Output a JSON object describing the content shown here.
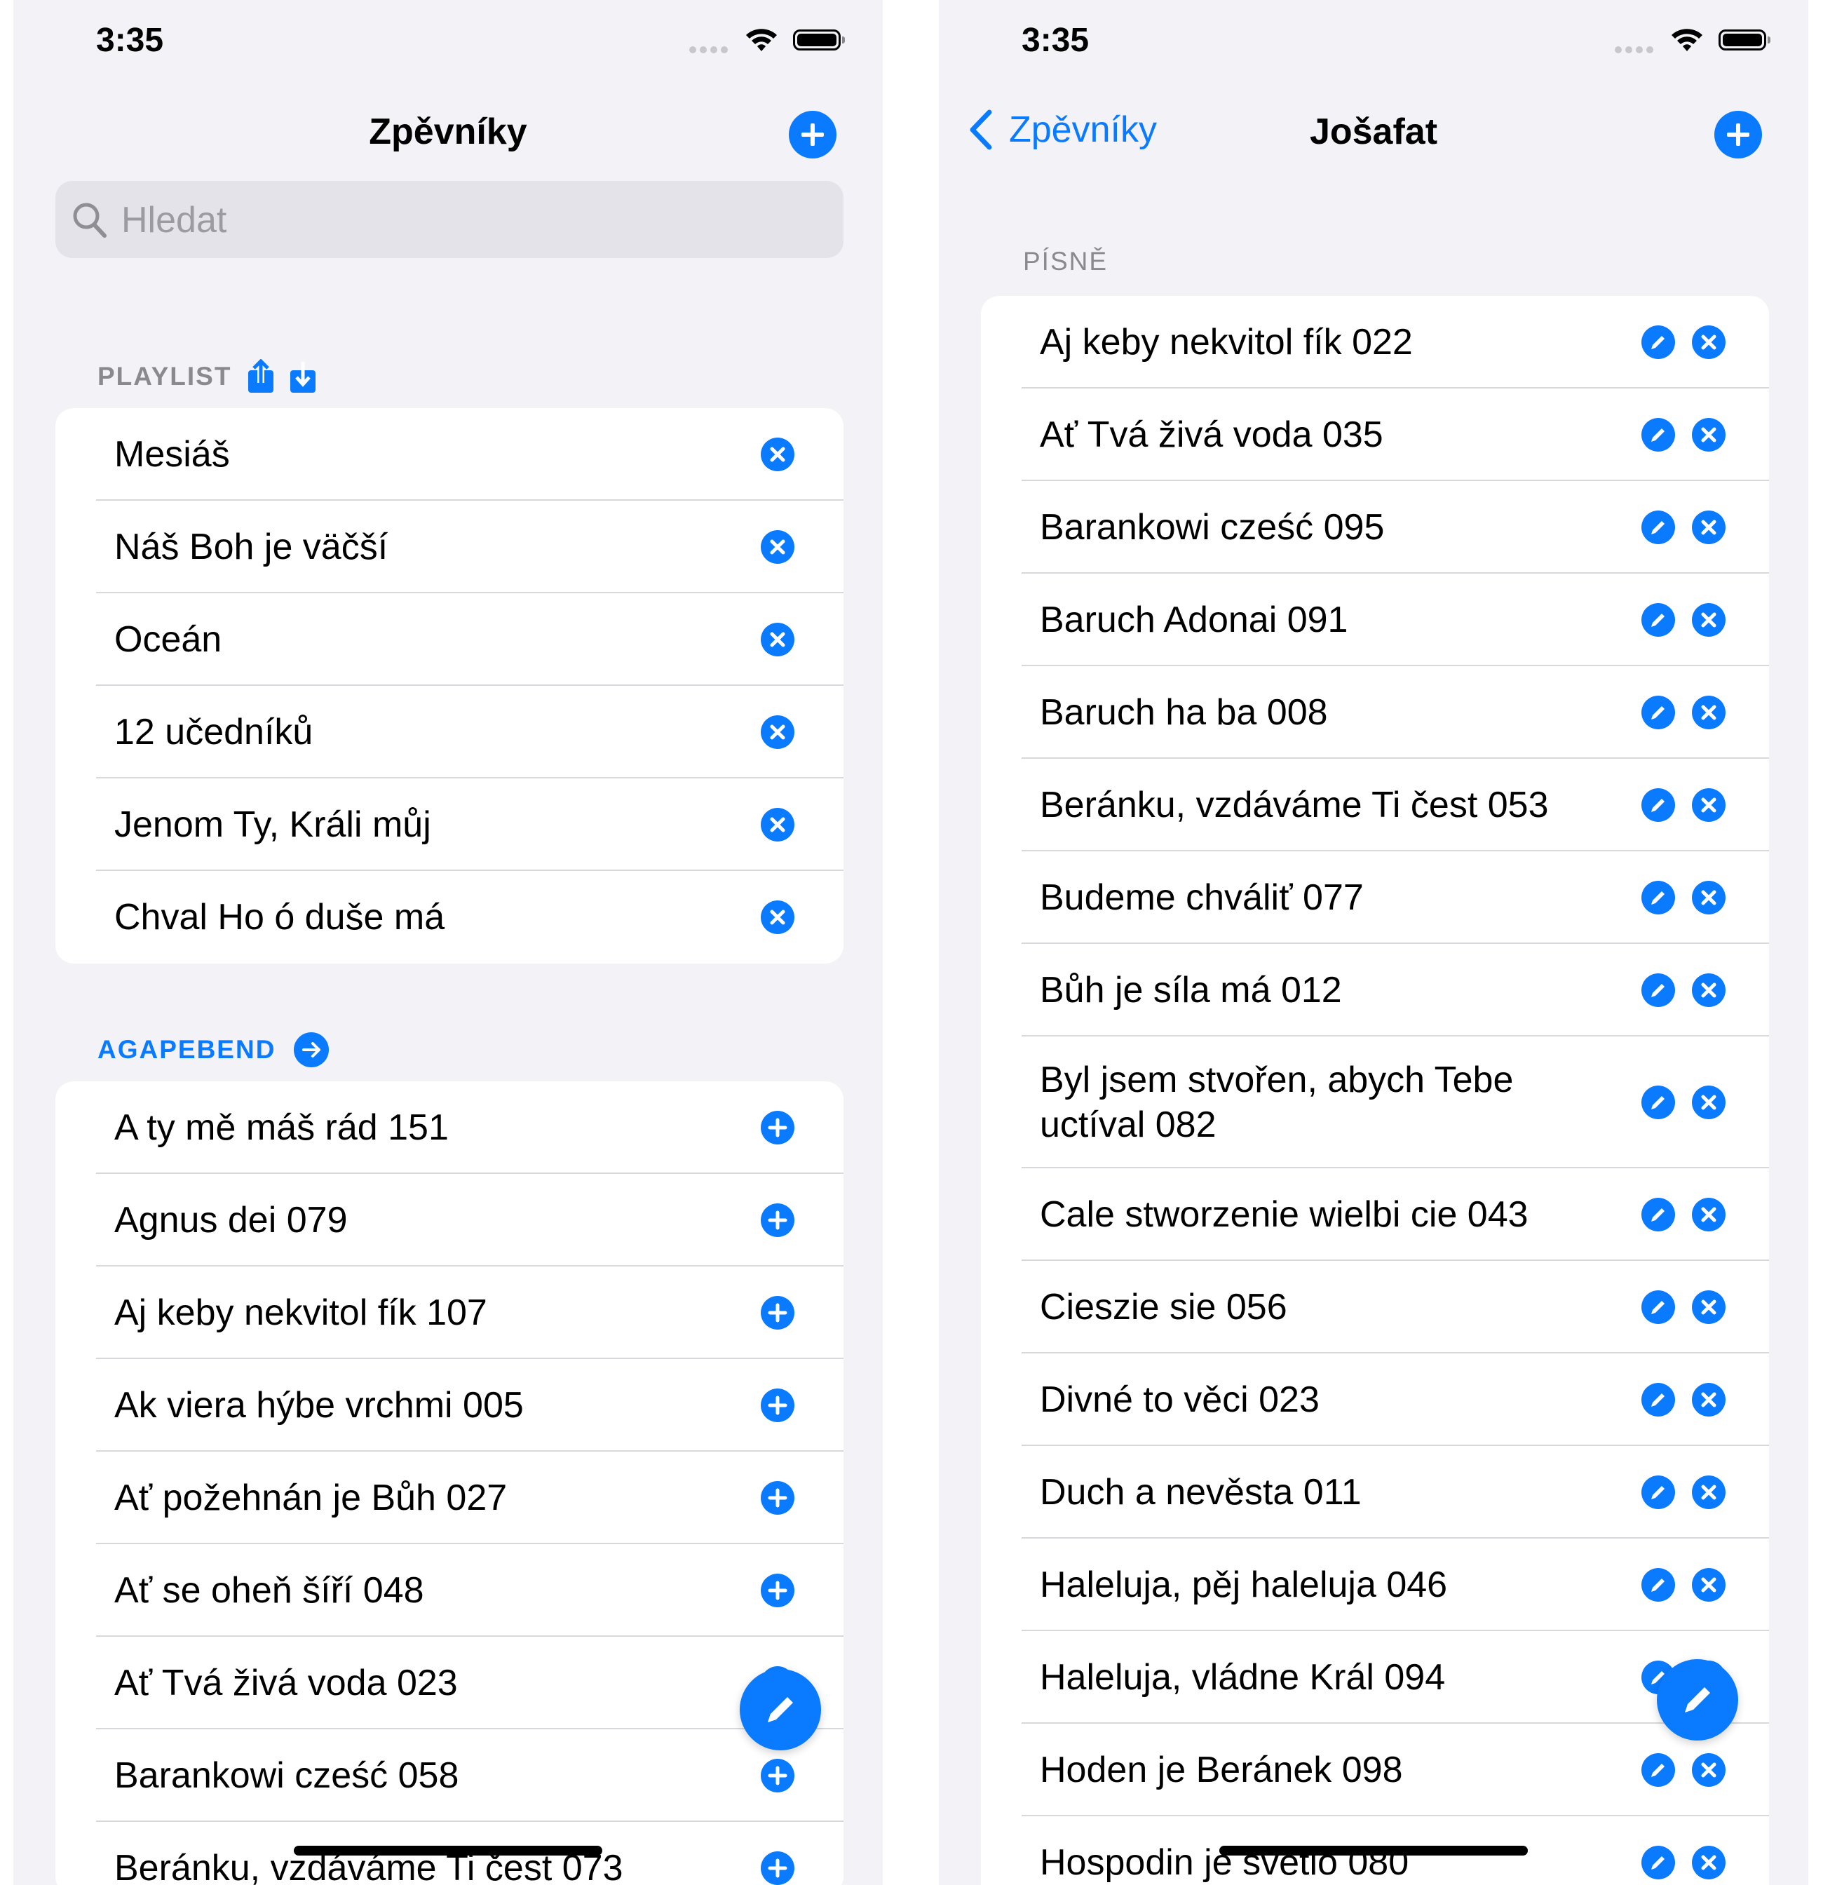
{
  "colors": {
    "accent": "#0a7aff",
    "background": "#f2f2f7",
    "card": "#ffffff"
  },
  "left": {
    "status_time": "3:35",
    "nav": {
      "title": "Zpěvníky",
      "add_icon": "plus-circle-icon"
    },
    "search": {
      "placeholder": "Hledat",
      "icon": "magnifier-icon"
    },
    "playlist": {
      "header": "PLAYLIST",
      "icons": [
        "share-upload-icon",
        "download-icon"
      ],
      "items": [
        {
          "title": "Mesiáš"
        },
        {
          "title": "Náš Boh je väčší"
        },
        {
          "title": "Oceán"
        },
        {
          "title": "12 učedníků"
        },
        {
          "title": "Jenom Ty, Králi můj"
        },
        {
          "title": "Chval Ho ó duše má"
        }
      ]
    },
    "songbook": {
      "header": "AGAPEBEND",
      "header_icon": "arrow-right-circle-icon",
      "items": [
        {
          "title": "A ty mě máš rád 151"
        },
        {
          "title": "Agnus dei 079"
        },
        {
          "title": "Aj keby nekvitol fík 107"
        },
        {
          "title": "Ak viera hýbe vrchmi 005"
        },
        {
          "title": "Ať požehnán je Bůh 027"
        },
        {
          "title": "Ať se oheň šíří 048"
        },
        {
          "title": "Ať Tvá živá voda 023"
        },
        {
          "title": "Barankowi cześć 058"
        },
        {
          "title": "Beránku, vzdáváme Ti čest 073"
        }
      ]
    },
    "fab_icon": "pencil-icon"
  },
  "right": {
    "status_time": "3:35",
    "nav": {
      "back_label": "Zpěvníky",
      "title": "Jošafat",
      "add_icon": "plus-circle-icon"
    },
    "songs": {
      "header": "PÍSNĚ",
      "items": [
        {
          "title": "Aj keby nekvitol fík 022"
        },
        {
          "title": "Ať Tvá živá voda 035"
        },
        {
          "title": "Barankowi cześć 095"
        },
        {
          "title": "Baruch Adonai 091"
        },
        {
          "title": "Baruch ha ba 008"
        },
        {
          "title": "Beránku, vzdáváme Ti čest 053"
        },
        {
          "title": "Budeme chváliť 077"
        },
        {
          "title": "Bůh je síla má 012"
        },
        {
          "title": "Byl jsem stvořen, abych Tebe uctíval 082"
        },
        {
          "title": "Cale stworzenie wielbi cie 043"
        },
        {
          "title": "Cieszie sie 056"
        },
        {
          "title": "Divné to věci 023"
        },
        {
          "title": "Duch a nevěsta 011"
        },
        {
          "title": "Haleluja, pěj haleluja 046"
        },
        {
          "title": "Haleluja, vládne Král 094"
        },
        {
          "title": "Hoden je Beránek 098"
        },
        {
          "title": "Hospodin je světlo 080"
        }
      ]
    },
    "fab_icon": "pencil-icon"
  }
}
